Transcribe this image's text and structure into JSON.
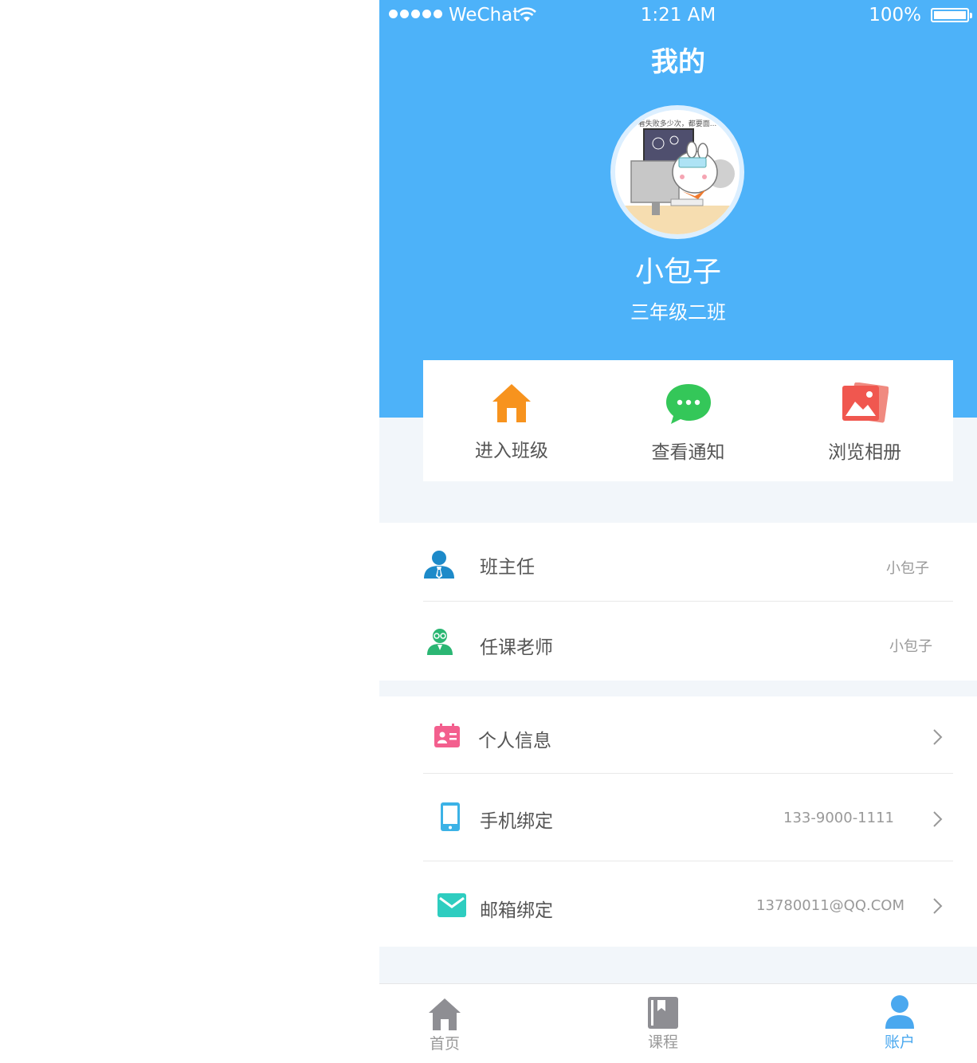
{
  "status_bar": {
    "carrier": "WeChat",
    "time": "1:21 AM",
    "battery": "100%"
  },
  "header": {
    "title": "我的",
    "user_name": "小包子",
    "class_name": "三年级二班",
    "avatar_caption": "看失败多少次，都要面..."
  },
  "quick_actions": [
    {
      "label": "进入班级",
      "icon": "house-icon",
      "color": "#f7931e"
    },
    {
      "label": "查看通知",
      "icon": "chat-bubble-icon",
      "color": "#34c759"
    },
    {
      "label": "浏览相册",
      "icon": "photo-album-icon",
      "color": "#f0574f"
    }
  ],
  "teachers": [
    {
      "label": "班主任",
      "value": "小包子",
      "icon": "person-tie-icon"
    },
    {
      "label": "任课老师",
      "value": "小包子",
      "icon": "teacher-glasses-icon"
    }
  ],
  "account": [
    {
      "label": "个人信息",
      "value": "",
      "icon": "id-card-icon"
    },
    {
      "label": "手机绑定",
      "value": "133-9000-1111",
      "icon": "phone-icon"
    },
    {
      "label": "邮箱绑定",
      "value": "13780011@QQ.COM",
      "icon": "mail-icon"
    }
  ],
  "tabs": [
    {
      "label": "首页",
      "icon": "home-tab-icon",
      "active": false
    },
    {
      "label": "课程",
      "icon": "book-tab-icon",
      "active": false
    },
    {
      "label": "账户",
      "icon": "account-tab-icon",
      "active": true
    }
  ],
  "colors": {
    "header": "#4db2f9",
    "active_tab": "#4aa8ef",
    "background": "#f2f6fa"
  }
}
